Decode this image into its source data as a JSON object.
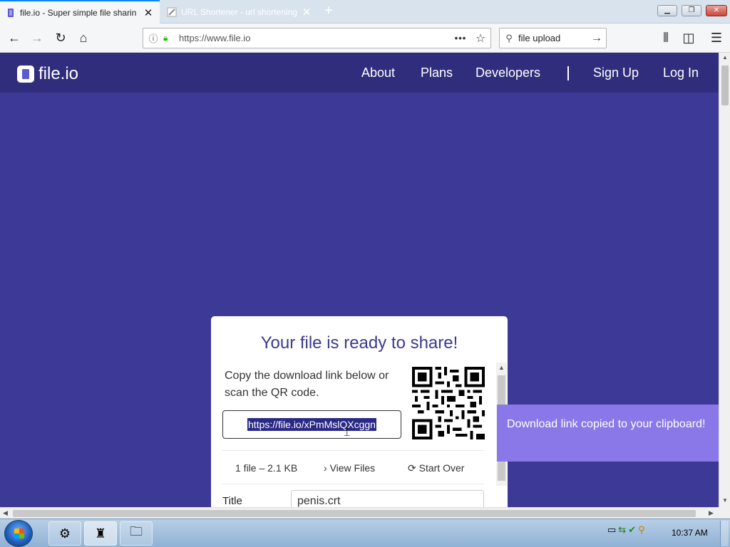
{
  "browser": {
    "tabs": [
      {
        "title": "file.io - Super simple file sharin",
        "active": true
      },
      {
        "title": "URL Shortener - url shortening",
        "active": false
      }
    ],
    "address": "https://www.file.io",
    "search_query": "file upload"
  },
  "site": {
    "logo_text": "file.io",
    "nav": [
      "About",
      "Plans",
      "Developers",
      "Sign Up",
      "Log In"
    ]
  },
  "card": {
    "title": "Your file is ready to share!",
    "copy_text": "Copy the download link below or scan the QR code.",
    "link": "https://file.io/xPmMslQXcggn",
    "file_count": "1 file – 2.1 KB",
    "view_files": "View Files",
    "start_over": "Start Over",
    "title_label": "Title",
    "title_value": "penis.crt"
  },
  "toast": {
    "message": "Download link copied to your clipboard!"
  },
  "taskbar": {
    "clock": "10:37 AM"
  },
  "colors": {
    "page_bg": "#3d3a97",
    "header_bg": "#302d7c",
    "toast_bg": "#8a78e8",
    "title_color": "#3b3a8f"
  }
}
